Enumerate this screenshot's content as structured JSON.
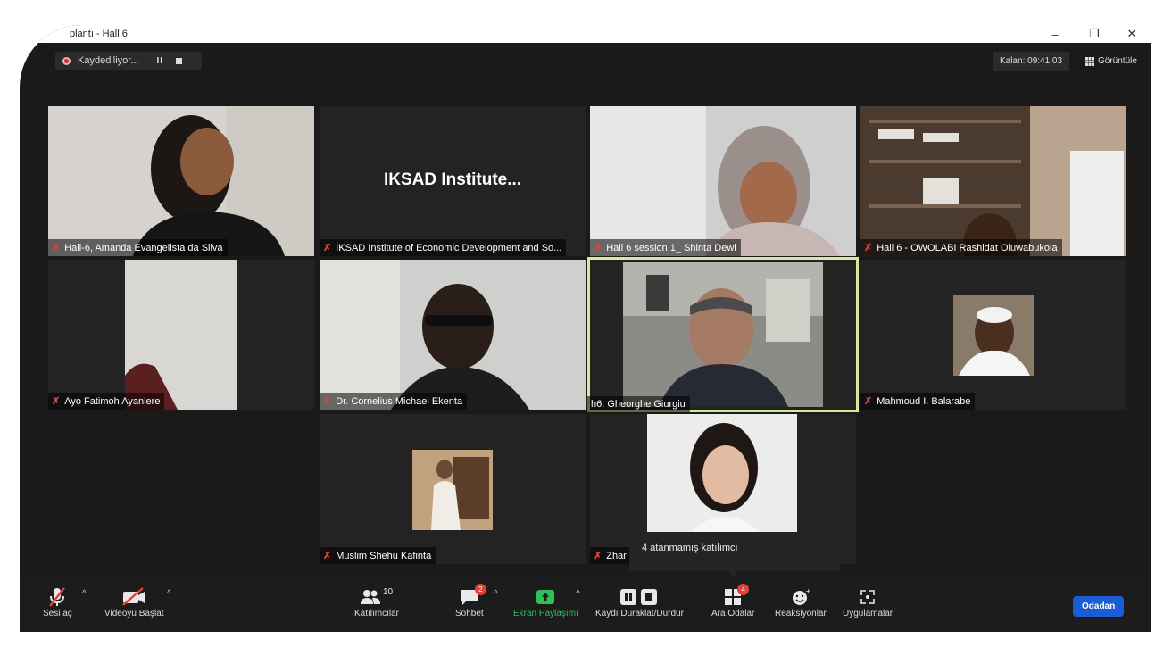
{
  "window": {
    "title": "plantı - Hall 6",
    "minimize": "–",
    "restore": "❐",
    "close": "✕"
  },
  "recording": {
    "status": "Kaydediliyor...",
    "pause_icon": "pause-icon",
    "stop_icon": "stop-icon"
  },
  "header": {
    "remaining": "Kalan: 09:41:03",
    "view_label": "Görüntüle"
  },
  "tiles": [
    {
      "name": "Hall-6, Amanda Evangelista da Silva",
      "muted": true
    },
    {
      "name": "IKSAD Institute of Economic Development and So...",
      "muted": true,
      "center_text": "IKSAD  Institute..."
    },
    {
      "name": "Hall 6 session 1_ Shinta Dewi",
      "muted": true
    },
    {
      "name": "Hall 6 - OWOLABI Rashidat Oluwabukola",
      "muted": true
    },
    {
      "name": "Ayo Fatimoh Ayanlere",
      "muted": true
    },
    {
      "name": "Dr. Cornelius Michael Ekenta",
      "muted": true
    },
    {
      "name": "h6: Gheorghe Giurgiu",
      "muted": false,
      "active": true
    },
    {
      "name": "Mahmoud I. Balarabe",
      "muted": true
    },
    {
      "name": "Muslim Shehu Kafinta",
      "muted": true
    },
    {
      "name": "Zhar",
      "muted": true
    }
  ],
  "tooltip": {
    "text": "4 atanmamış katılımcı"
  },
  "toolbar": {
    "unmute": "Sesi aç",
    "start_video": "Videoyu Başlat",
    "participants": "Katılımcılar",
    "participants_count": "10",
    "chat": "Sohbet",
    "chat_badge": "2",
    "share": "Ekran Paylaşımı",
    "record": "Kaydı Duraklat/Durdur",
    "breakout": "Ara Odalar",
    "breakout_badge": "4",
    "reactions": "Reaksiyonlar",
    "apps": "Uygulamalar",
    "leave": "Odadan"
  },
  "colors": {
    "share_green": "#2fc05a",
    "mute_red": "#e0413b",
    "leave_blue": "#1a5bd6",
    "active_border": "#d8e8a0"
  }
}
